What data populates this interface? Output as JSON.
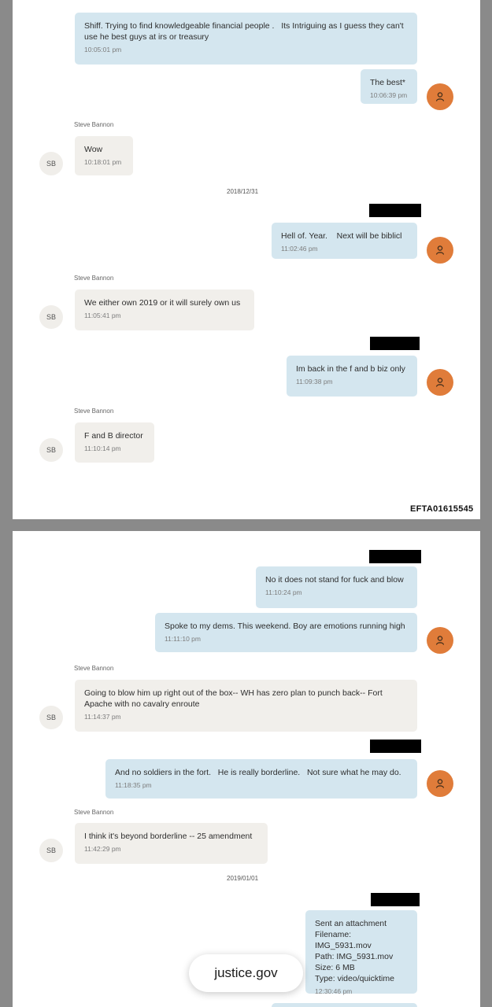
{
  "page1": {
    "messages": [
      {
        "text": "Shiff. Trying to find knowledgeable financial people .   Its Intriguing as I guess they can't use he best guys at irs or treasury",
        "time": "10:05:01 pm"
      },
      {
        "text": "The best*",
        "time": "10:06:39 pm"
      },
      {
        "sender": "Steve Bannon",
        "avatar": "SB",
        "text": "Wow",
        "time": "10:18:01 pm"
      },
      {
        "date": "2018/12/31"
      },
      {
        "text": "Hell of. Year.    Next will be biblicl",
        "time": "11:02:46 pm"
      },
      {
        "sender": "Steve Bannon",
        "avatar": "SB",
        "text": "We either own 2019 or it will surely own us",
        "time": "11:05:41 pm"
      },
      {
        "text": "Im back in the f and b biz only",
        "time": "11:09:38 pm"
      },
      {
        "sender": "Steve Bannon",
        "avatar": "SB",
        "text": "F and B director",
        "time": "11:10:14 pm"
      }
    ],
    "doc_id": "EFTA01615545"
  },
  "page2": {
    "messages": [
      {
        "text": "No it does not stand for fuck and blow",
        "time": "11:10:24 pm"
      },
      {
        "text": "Spoke to my dems. This weekend. Boy are emotions running high",
        "time": "11:11:10 pm"
      },
      {
        "sender": "Steve Bannon",
        "avatar": "SB",
        "text": "Going to blow him up right out of the box-- WH has zero plan to punch back-- Fort Apache with no cavalry enroute",
        "time": "11:14:37 pm"
      },
      {
        "text": "And no soldiers in the fort.   He is really borderline.   Not sure what he may do.",
        "time": "11:18:35 pm"
      },
      {
        "sender": "Steve Bannon",
        "avatar": "SB",
        "text": "I think it's beyond borderline -- 25 amendment",
        "time": "11:42:29 pm"
      },
      {
        "date": "2019/01/01"
      },
      {
        "attachment": {
          "title": "Sent an attachment",
          "filename": "Filename: IMG_5931.mov",
          "path": "Path: IMG_5931.mov",
          "size": "Size: 6 MB",
          "type": "Type: video/quicktime",
          "time": "12:30:46 pm"
        }
      }
    ]
  },
  "footer": {
    "site": "justice.gov"
  },
  "colors": {
    "outgoing_bubble": "#d4e6ef",
    "incoming_bubble": "#f1efeb",
    "outgoing_avatar": "#e07c3a",
    "redaction": "#000000"
  },
  "icons": {
    "outgoing_avatar": "person-icon"
  }
}
